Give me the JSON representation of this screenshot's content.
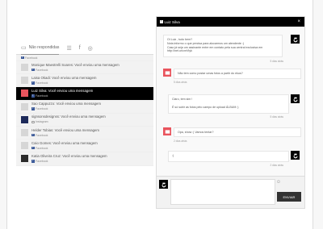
{
  "inbox": {
    "tabs": [
      {
        "label": "Não respondidas"
      }
    ],
    "rows": [
      {
        "message": "",
        "source": "Facebook",
        "avatar": "grey",
        "network": "fb"
      },
      {
        "message": "Monique Maestrelli Soares: Você enviou uma mensagem",
        "source": "Facebook",
        "avatar": "grey",
        "network": "fb"
      },
      {
        "message": "Laisa Okadi: Você enviou uma mensagem",
        "source": "Facebook",
        "avatar": "grey",
        "network": "fb"
      },
      {
        "message": "Luiz Silva: Você enviou uma mensagem",
        "source": "Facebook",
        "avatar": "red",
        "network": "fb",
        "active": true
      },
      {
        "message": "Sao Cappuzzo: Você enviou uma mensagem",
        "source": "Facebook",
        "avatar": "grey",
        "network": "fb"
      },
      {
        "message": "signsonsdesignss: Você enviou uma mensagem",
        "source": "Instagram",
        "avatar": "dark",
        "network": "ig"
      },
      {
        "message": "Helder Tobias: Você enviou uma mensagem",
        "source": "Facebook",
        "avatar": "grey",
        "network": "fb"
      },
      {
        "message": "Caio Gomes: Você enviou uma mensagem",
        "source": "Facebook",
        "avatar": "grey",
        "network": "fb"
      },
      {
        "message": "Katia Oliveira Cruz: Você enviou uma mensagem",
        "source": "Facebook",
        "avatar": "dark2",
        "network": "fb"
      }
    ]
  },
  "chat": {
    "title": "Luiz Silva",
    "close": "×",
    "m1": "Oi Luiz , tudo bem?\nNota informo o que precisa para alocarmos um atendente :)\nCaso já seja um assinante entre em contato pela sua central exclusiva em http://net.ur/cmVtyk",
    "t1": "5 dias atrás",
    "m2": "Não tem como postar umas fotos a partir do ekus?",
    "t2": "5 dias atrás",
    "m3": "Claro, tem sim !\n\nÉ só subir as fotos pelo campo de upload ÁLBUM :)",
    "t3": "5 dias atrás",
    "m4": "Opa, show :) Vamos tentar?",
    "t4": "2 dias atrás",
    "m5": ":)",
    "t5": "2 dias atrás",
    "send_label": "ENVIAR",
    "emoji": "☺"
  }
}
